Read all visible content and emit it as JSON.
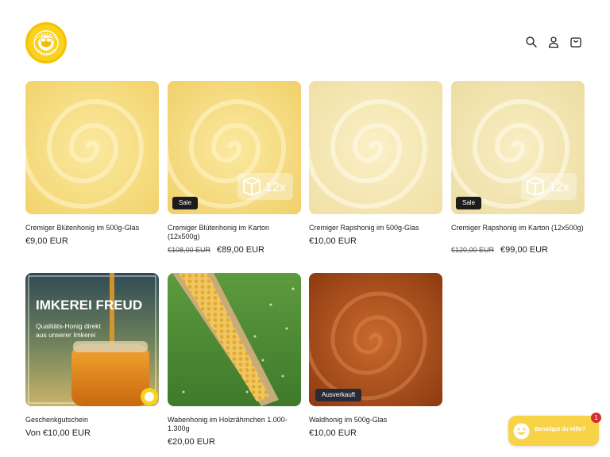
{
  "header": {
    "icons": [
      "search-icon",
      "account-icon",
      "cart-icon"
    ]
  },
  "products": [
    {
      "title": "Cremiger Blütenhonig im 500g-Glas",
      "price": "€9,00 EUR"
    },
    {
      "title": "Cremiger Blütenhonig im Karton (12x500g)",
      "old_price": "€108,00 EUR",
      "price": "€89,00 EUR",
      "badge": "Sale",
      "pack_label": "12x"
    },
    {
      "title": "Cremiger Rapshonig im 500g-Glas",
      "price": "€10,00 EUR"
    },
    {
      "title": "Cremiger Rapshonig im Karton (12x500g)",
      "old_price": "€120,00 EUR",
      "price": "€99,00 EUR",
      "badge": "Sale",
      "pack_label": "12x"
    },
    {
      "title": "Geschenkgutschein",
      "price": "Von €10,00 EUR",
      "image_heading": "IMKEREI FREUD",
      "image_sub_1": "Qualitäts-Honig direkt",
      "image_sub_2": "aus unserer Imkerei"
    },
    {
      "title": "Wabenhonig im Holzrähmchen 1.000-1.300g",
      "price": "€20,00 EUR"
    },
    {
      "title": "Waldhonig im 500g-Glas",
      "price": "€10,00 EUR",
      "badge": "Ausverkauft"
    }
  ],
  "chat": {
    "text": "Benötigst du Hilfe?",
    "count": "1"
  },
  "colors": {
    "brand_yellow": "#f8d21c",
    "chat_yellow": "#f8d348",
    "badge_bg": "#1c1c1c",
    "notification_red": "#d32f2f"
  }
}
